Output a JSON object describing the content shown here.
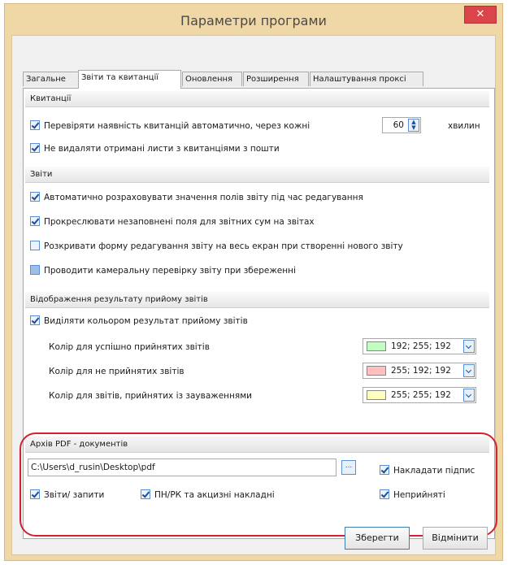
{
  "window": {
    "title": "Параметри програми",
    "close_glyph": "✕"
  },
  "tabs": [
    {
      "label": "Загальне"
    },
    {
      "label": "Звіти та квитанції"
    },
    {
      "label": "Оновлення"
    },
    {
      "label": "Розширення"
    },
    {
      "label": "Налаштування проксі"
    }
  ],
  "receipts": {
    "header": "Квитанції",
    "check_label": "Перевіряти наявність квитанцій автоматично, через кожні",
    "check_checked": true,
    "interval_value": "60",
    "interval_unit": "хвилин",
    "keep_label": "Не видаляти отримані листи з квитанціями з пошти",
    "keep_checked": true
  },
  "reports": {
    "header": "Звіти",
    "items": [
      {
        "label": "Автоматично розраховувати значення полів звіту під час редагування",
        "checked": true
      },
      {
        "label": "Прокреслювати незаповнені поля для звітних сум на звітах",
        "checked": true
      },
      {
        "label": "Розкривати форму редагування звіту на весь екран при створенні нового звіту",
        "checked": false
      },
      {
        "label": "Проводити камеральну перевірку звіту при збереженні",
        "checked": "partial"
      }
    ]
  },
  "display": {
    "header": "Відображення результату прийому звітів",
    "highlight_label": "Виділяти кольором результат прийому звітів",
    "highlight_checked": true,
    "colors": [
      {
        "label": "Колір для успішно прийнятих звітів",
        "value": "192; 255; 192",
        "swatch": "#c0ffc0"
      },
      {
        "label": "Колір для не прийнятих звітів",
        "value": "255; 192; 192",
        "swatch": "#ffc0c0"
      },
      {
        "label": "Колір для звітів, прийнятих із зауваженнями",
        "value": "255; 255; 192",
        "swatch": "#ffffc0"
      }
    ]
  },
  "pdf": {
    "header": "Архів PDF - документів",
    "path": "C:\\Users\\d_rusin\\Desktop\\pdf",
    "browse_label": "...",
    "sign_label": "Накладати підпис",
    "sign_checked": true,
    "reports_label": "Звіти/ запити",
    "reports_checked": true,
    "invoices_label": "ПН/РК та акцизні накладні",
    "invoices_checked": true,
    "rejected_label": "Неприйняті",
    "rejected_checked": true
  },
  "buttons": {
    "save": "Зберегти",
    "cancel": "Відмінити"
  },
  "colors": {
    "highlight_oval": "#d2222f",
    "frame": "#f0d7a6",
    "close": "#d9454a"
  }
}
